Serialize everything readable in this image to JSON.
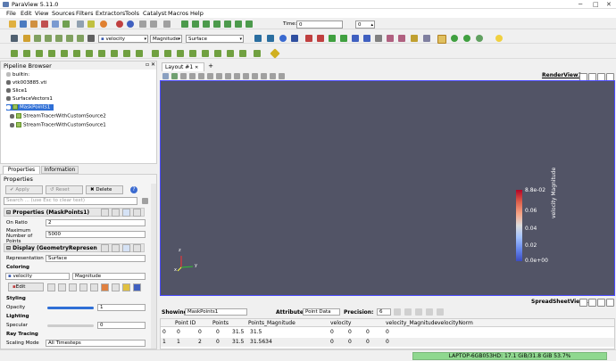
{
  "window": {
    "title": "ParaView 5.11.0"
  },
  "menu": [
    "File",
    "Edit",
    "View",
    "Sources",
    "Filters",
    "Extractors",
    "Tools",
    "Catalyst",
    "Macros",
    "Help"
  ],
  "toolbar": {
    "time_label": "Time:",
    "time_value": "0",
    "time_index": "0",
    "color_by": "velocity",
    "component": "Magnitude",
    "representation": "Surface"
  },
  "pipeline": {
    "title": "Pipeline Browser",
    "items": [
      {
        "label": "builtin:"
      },
      {
        "label": "vtk003885.vti"
      },
      {
        "label": "Slice1"
      },
      {
        "label": "SurfaceVectors1"
      },
      {
        "label": "MaskPoints1"
      },
      {
        "label": "StreamTracerWithCustomSource2"
      },
      {
        "label": "StreamTracerWithCustomSource1"
      }
    ]
  },
  "tabs": {
    "properties": "Properties",
    "information": "Information"
  },
  "properties": {
    "header": "Properties",
    "apply": "Apply",
    "reset": "Reset",
    "delete": "Delete",
    "search_placeholder": "Search ... (use Esc to clear text)",
    "section_props": "Properties (MaskPoints1)",
    "on_ratio_label": "On Ratio",
    "on_ratio_value": "2",
    "max_points_label": "Maximum Number of Points",
    "max_points_value": "5000",
    "section_display": "Display (GeometryRepresen",
    "representation_label": "Representation",
    "representation_value": "Surface",
    "coloring_label": "Coloring",
    "color_array": "velocity",
    "color_component": "Magnitude",
    "edit_label": "Edit",
    "styling_label": "Styling",
    "opacity_label": "Opacity",
    "opacity_value": "1",
    "opacity_level": 1.0,
    "lighting_label": "Lighting",
    "specular_label": "Specular",
    "specular_value": "0",
    "raytracing_label": "Ray Tracing",
    "scaling_mode_label": "Scaling Mode",
    "scaling_mode_value": "All Timesteps"
  },
  "layout": {
    "tab_label": "Layout #1",
    "render_view": "RenderView1"
  },
  "colorbar": {
    "title": "velocity Magnitude",
    "ticks": [
      "8.8e-02",
      "0.06",
      "0.04",
      "0.02",
      "0.0e+00"
    ]
  },
  "axes": {
    "x": "x",
    "y": "y",
    "z": "z"
  },
  "spreadsheet": {
    "title": "SpreadSheetView1",
    "showing_label": "Showing",
    "showing_value": "MaskPoints1",
    "attribute_label": "Attribute:",
    "attribute_value": "Point Data",
    "precision_label": "Precision:",
    "precision_value": "6",
    "columns": [
      "Point ID",
      "Points",
      "Points_Magnitude",
      "velocity",
      "velocity_Magnitude",
      "velocityNorm"
    ],
    "rows": [
      [
        "0",
        "0",
        "0",
        "0",
        "31.5",
        "31.5",
        "0",
        "0",
        "0",
        "0"
      ],
      [
        "1",
        "1",
        "2",
        "0",
        "31.5",
        "31.5634",
        "0",
        "0",
        "0",
        "0"
      ]
    ]
  },
  "status": {
    "memory": "LAPTOP-6GB053HD: 17.1 GiB/31.8 GiB 53.7%"
  },
  "colors": {
    "accent": "#4b4bff",
    "render_bg": "#525466",
    "memory_bar": "#8fd88f"
  }
}
